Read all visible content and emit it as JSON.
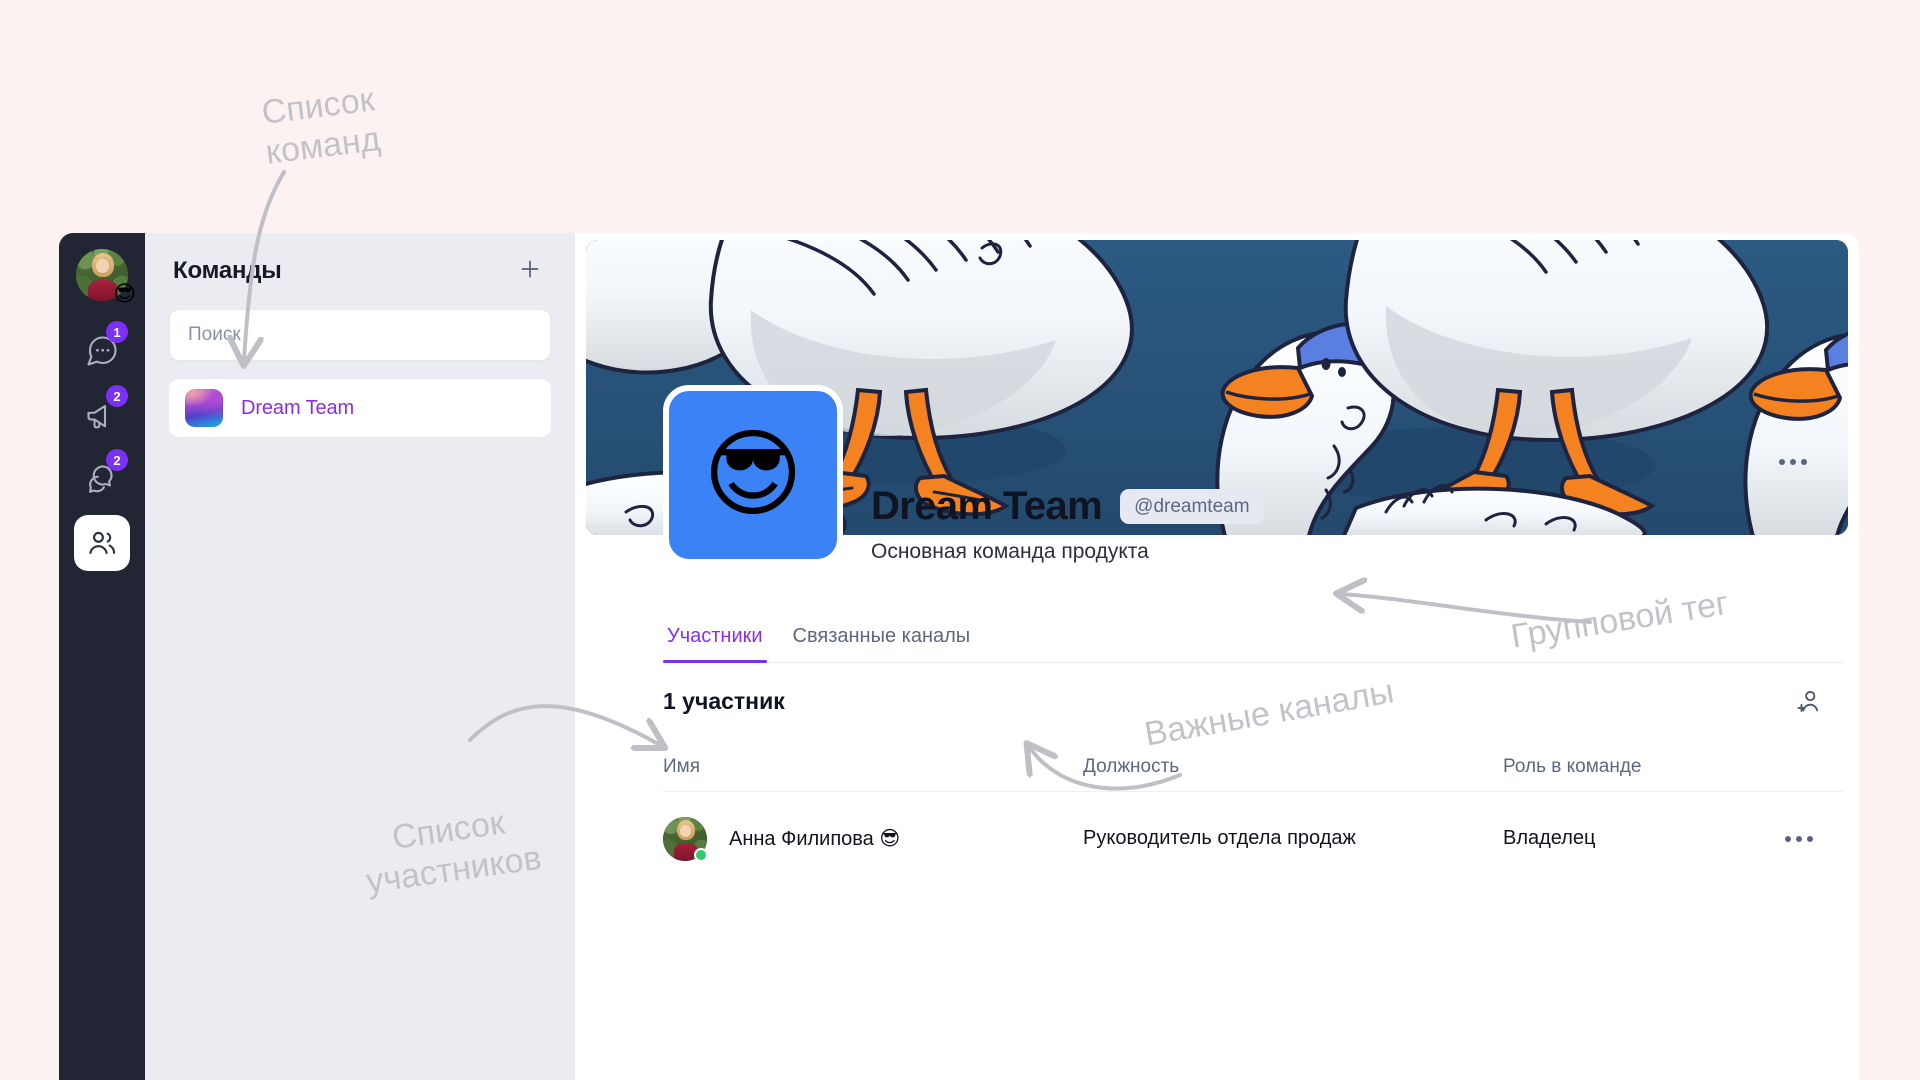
{
  "page": {
    "background_color": "#fdf2f2",
    "annotation_color": "#c2c3c9"
  },
  "rail": {
    "avatar": {
      "name": "user-avatar",
      "status_emoji": "😎"
    },
    "items": [
      {
        "icon": "chat-bubble-icon",
        "badge": "1",
        "active": false
      },
      {
        "icon": "megaphone-icon",
        "badge": "2",
        "active": false
      },
      {
        "icon": "threads-icon",
        "badge": "2",
        "active": false
      },
      {
        "icon": "people-icon",
        "badge": "",
        "active": true
      }
    ]
  },
  "sidebar": {
    "title": "Команды",
    "add_button_label": "+",
    "search": {
      "placeholder": "Поиск",
      "value": ""
    },
    "teams": [
      {
        "name": "Dream Team",
        "selected": true
      }
    ]
  },
  "main": {
    "banner": {
      "alt": "geese-banner",
      "background_color": "#2a5278"
    },
    "team": {
      "avatar_emoji": "😎",
      "avatar_background": "#3b82f6",
      "title": "Dream Team",
      "tag": "@dreamteam",
      "subtitle": "Основная команда продукта",
      "more_button_label": "•••"
    },
    "tabs": [
      {
        "label": "Участники",
        "active": true
      },
      {
        "label": "Связанные каналы",
        "active": false
      }
    ],
    "members_count": "1 участник",
    "add_member_icon": "add-person-icon",
    "table": {
      "columns": [
        "Имя",
        "Должность",
        "Роль в команде"
      ],
      "rows": [
        {
          "name": "Анна Филипова 😎",
          "position": "Руководитель отдела продаж",
          "role": "Владелец",
          "online": true,
          "actions_label": "•••"
        }
      ]
    }
  },
  "annotations": {
    "teams_list": "Список\nкоманд",
    "members_list": "Список\nучастников",
    "group_tag": "Групповой тег",
    "important_channels": "Важные каналы"
  },
  "colors": {
    "accent_purple": "#7b2ff7",
    "link_purple": "#8b2fe0",
    "rail_dark": "#222634",
    "sidebar_grey": "#eaecf1",
    "online_green": "#2ecc71"
  }
}
